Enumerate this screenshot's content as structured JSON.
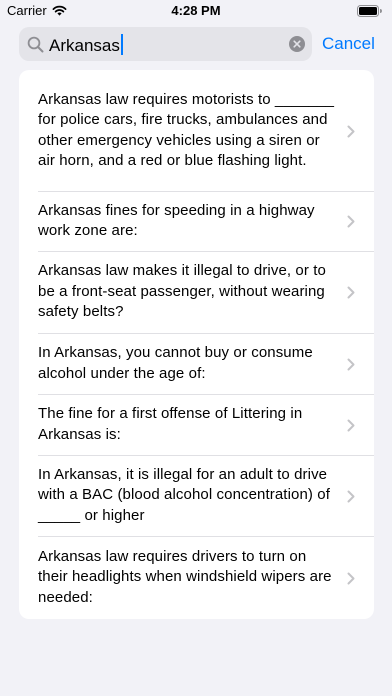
{
  "status_bar": {
    "carrier": "Carrier",
    "time": "4:28 PM"
  },
  "search": {
    "value": "Arkansas",
    "cancel_label": "Cancel"
  },
  "results": [
    {
      "text": "Arkansas law requires motorists to _______ for police cars, fire trucks, ambulances and other emergency vehicles using a siren or air horn, and a red or blue flashing light."
    },
    {
      "text": "Arkansas fines for speeding in a highway work zone are:"
    },
    {
      "text": "Arkansas law makes it illegal to drive, or to be a front-seat passenger, without wearing safety belts?"
    },
    {
      "text": "In Arkansas, you cannot buy or consume alcohol under the age of:"
    },
    {
      "text": "The fine for a first offense of Littering in Arkansas is:"
    },
    {
      "text": "In Arkansas, it is illegal for an adult to drive with a BAC (blood alcohol concentration) of _____ or higher"
    },
    {
      "text": "Arkansas law requires drivers to turn on their headlights when windshield wipers are needed:"
    }
  ],
  "colors": {
    "accent": "#007aff",
    "background": "#f2f2f7",
    "search_field": "#e4e4e9",
    "chevron": "#c4c4c7"
  }
}
